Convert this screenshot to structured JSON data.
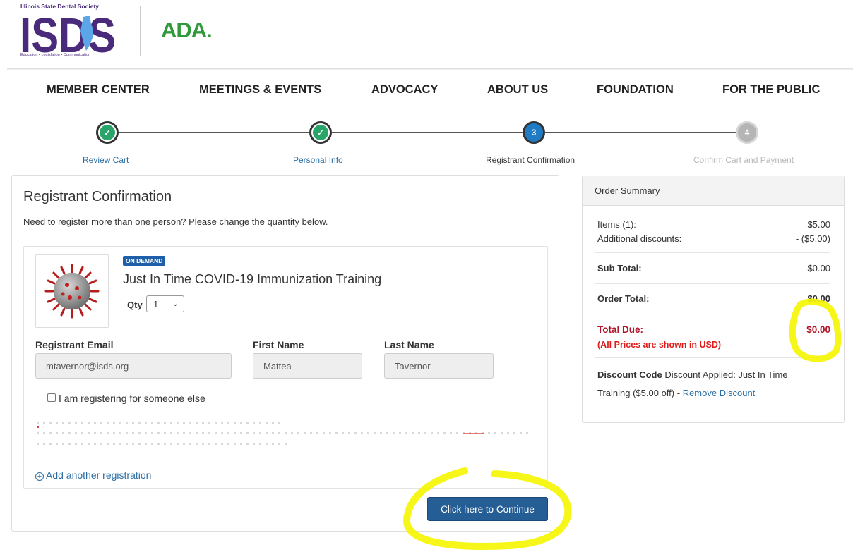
{
  "header": {
    "org_name": "Illinois State Dental Society",
    "logo_text": "ISDS",
    "tagline": "Education • Legislation • Communication",
    "partner_logo": "ADA."
  },
  "nav": [
    "MEMBER CENTER",
    "MEETINGS & EVENTS",
    "ADVOCACY",
    "ABOUT US",
    "FOUNDATION",
    "FOR THE PUBLIC"
  ],
  "steps": [
    {
      "number": "1",
      "label": "Review Cart",
      "state": "done"
    },
    {
      "number": "2",
      "label": "Personal Info",
      "state": "done"
    },
    {
      "number": "3",
      "label": "Registrant Confirmation",
      "state": "current"
    },
    {
      "number": "4",
      "label": "Confirm Cart and Payment",
      "state": "upcoming"
    }
  ],
  "registration": {
    "title": "Registrant Confirmation",
    "intro": "Need to register more than one person? Please change the quantity below.",
    "badge": "ON DEMAND",
    "product_name": "Just In Time COVID-19 Immunization Training",
    "qty_label": "Qty",
    "qty_value": "1",
    "email_label": "Registrant Email",
    "email_value": "mtavernor@isds.org",
    "first_label": "First Name",
    "first_value": "Mattea",
    "last_label": "Last Name",
    "last_value": "Tavernor",
    "someone_else_label": "I am registering for someone else",
    "add_registration": "Add another registration",
    "continue_button": "Click here to Continue"
  },
  "order_summary": {
    "title": "Order Summary",
    "items_label": "Items (1):",
    "items_value": "$5.00",
    "discounts_label": "Additional discounts:",
    "discounts_value": "- ($5.00)",
    "subtotal_label": "Sub Total:",
    "subtotal_value": "$0.00",
    "order_total_label": "Order Total:",
    "order_total_value": "$0.00",
    "total_due_label": "Total Due:",
    "total_due_value": "$0.00",
    "currency_note": "(All Prices are shown in USD)",
    "discount_code_label": "Discount Code",
    "discount_applied_1": "Discount Applied: Just In Time",
    "discount_applied_2": "Training ($5.00 off) -",
    "remove_discount": "Remove Discount"
  },
  "colors": {
    "brand_purple": "#4a2a7a",
    "ada_green": "#2f9a3a",
    "step_done": "#2aa56a",
    "step_current": "#1f7cc4",
    "button_blue": "#255d95",
    "total_due_red": "#b0152a",
    "highlighter": "#f5f500"
  }
}
